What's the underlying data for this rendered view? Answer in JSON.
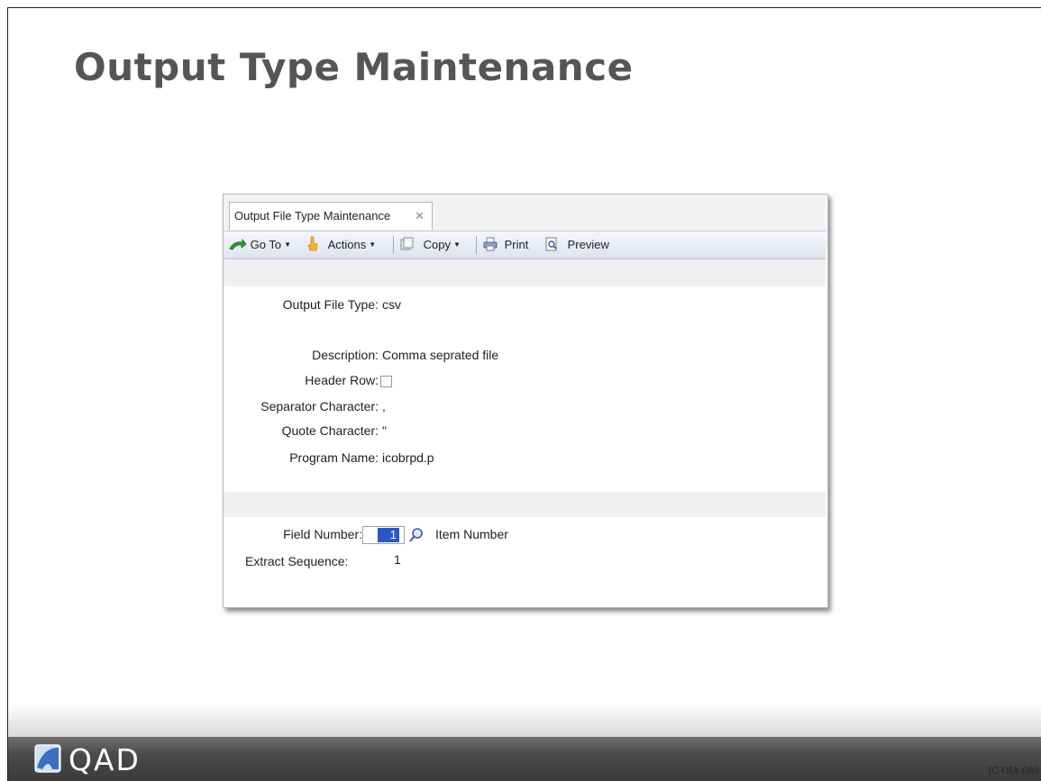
{
  "slide": {
    "title": "Output Type Maintenance",
    "code": "IC-OIA-080"
  },
  "app": {
    "tab_label": "Output File Type Maintenance",
    "toolbar": {
      "goto": "Go To",
      "actions": "Actions",
      "copy": "Copy",
      "print": "Print",
      "preview": "Preview"
    },
    "fields": {
      "output_file_type_label": "Output File Type:",
      "output_file_type_value": "csv",
      "description_label": "Description:",
      "description_value": "Comma seprated file",
      "header_row_label": "Header Row:",
      "header_row_checked": false,
      "separator_label": "Separator Character:",
      "separator_value": ",",
      "quote_label": "Quote Character:",
      "quote_value": "\"",
      "program_label": "Program Name:",
      "program_value": "icobrpd.p",
      "field_number_label": "Field Number:",
      "field_number_value": "1",
      "field_number_desc": "Item Number",
      "extract_label": "Extract Sequence:",
      "extract_value": "1"
    }
  },
  "footer": {
    "logo_text": "QAD"
  }
}
